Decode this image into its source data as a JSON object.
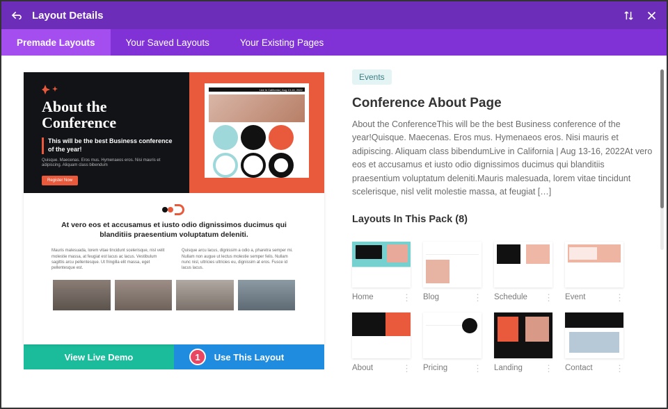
{
  "header": {
    "title": "Layout Details"
  },
  "tabs": {
    "premade": "Premade Layouts",
    "saved": "Your Saved Layouts",
    "existing": "Your Existing Pages"
  },
  "preview": {
    "title_line1": "About the",
    "title_line2": "Conference",
    "subtitle": "This will be the best Business conference of the year!",
    "micro": "Quisque. Maecenas. Eros mus. Hymenaeos eros. Nisi mauris et adipiscing. Aliquam class bibendum",
    "cta": "Register Now",
    "card_bar": "Live in California | Aug 13-16, 2022",
    "mid_heading": "At vero eos et accusamus et iusto odio dignissimos ducimus qui blanditiis praesentium voluptatum deleniti.",
    "col1": "Mauris malesuada, lorem vitae tincidunt scelerisque, nisl velit molestie massa, at feugiat est lacus ac lacus. Vestibulum sagittis arcu pellentesque. Ut fringilla elit massa, eget pellentesque est.",
    "col2": "Quisque arcu lacus, dignissim a odio a, pharetra semper mi. Nullam non augue ut lectus molestie semper felis. Nullam nunc nisl, ultricies ultricies eu, dignissim at eros. Fusce id lacus lacus."
  },
  "actions": {
    "demo": "View Live Demo",
    "use": "Use This Layout",
    "badge": "1"
  },
  "right": {
    "tag": "Events",
    "title": "Conference About Page",
    "description": "About the ConferenceThis will be the best Business conference of the year!Quisque. Maecenas. Eros mus. Hymenaeos eros. Nisi mauris et adipiscing. Aliquam class bibendumLive in California | Aug 13-16, 2022At vero eos et accusamus et iusto odio dignissimos ducimus qui blanditiis praesentium voluptatum deleniti.Mauris malesuada, lorem vitae tincidunt scelerisque, nisl velit molestie massa, at feugiat […]",
    "pack_title": "Layouts In This Pack (8)",
    "cards": {
      "home": "Home",
      "blog": "Blog",
      "schedule": "Schedule",
      "event": "Event",
      "about": "About",
      "pricing": "Pricing",
      "landing": "Landing",
      "contact": "Contact"
    }
  }
}
